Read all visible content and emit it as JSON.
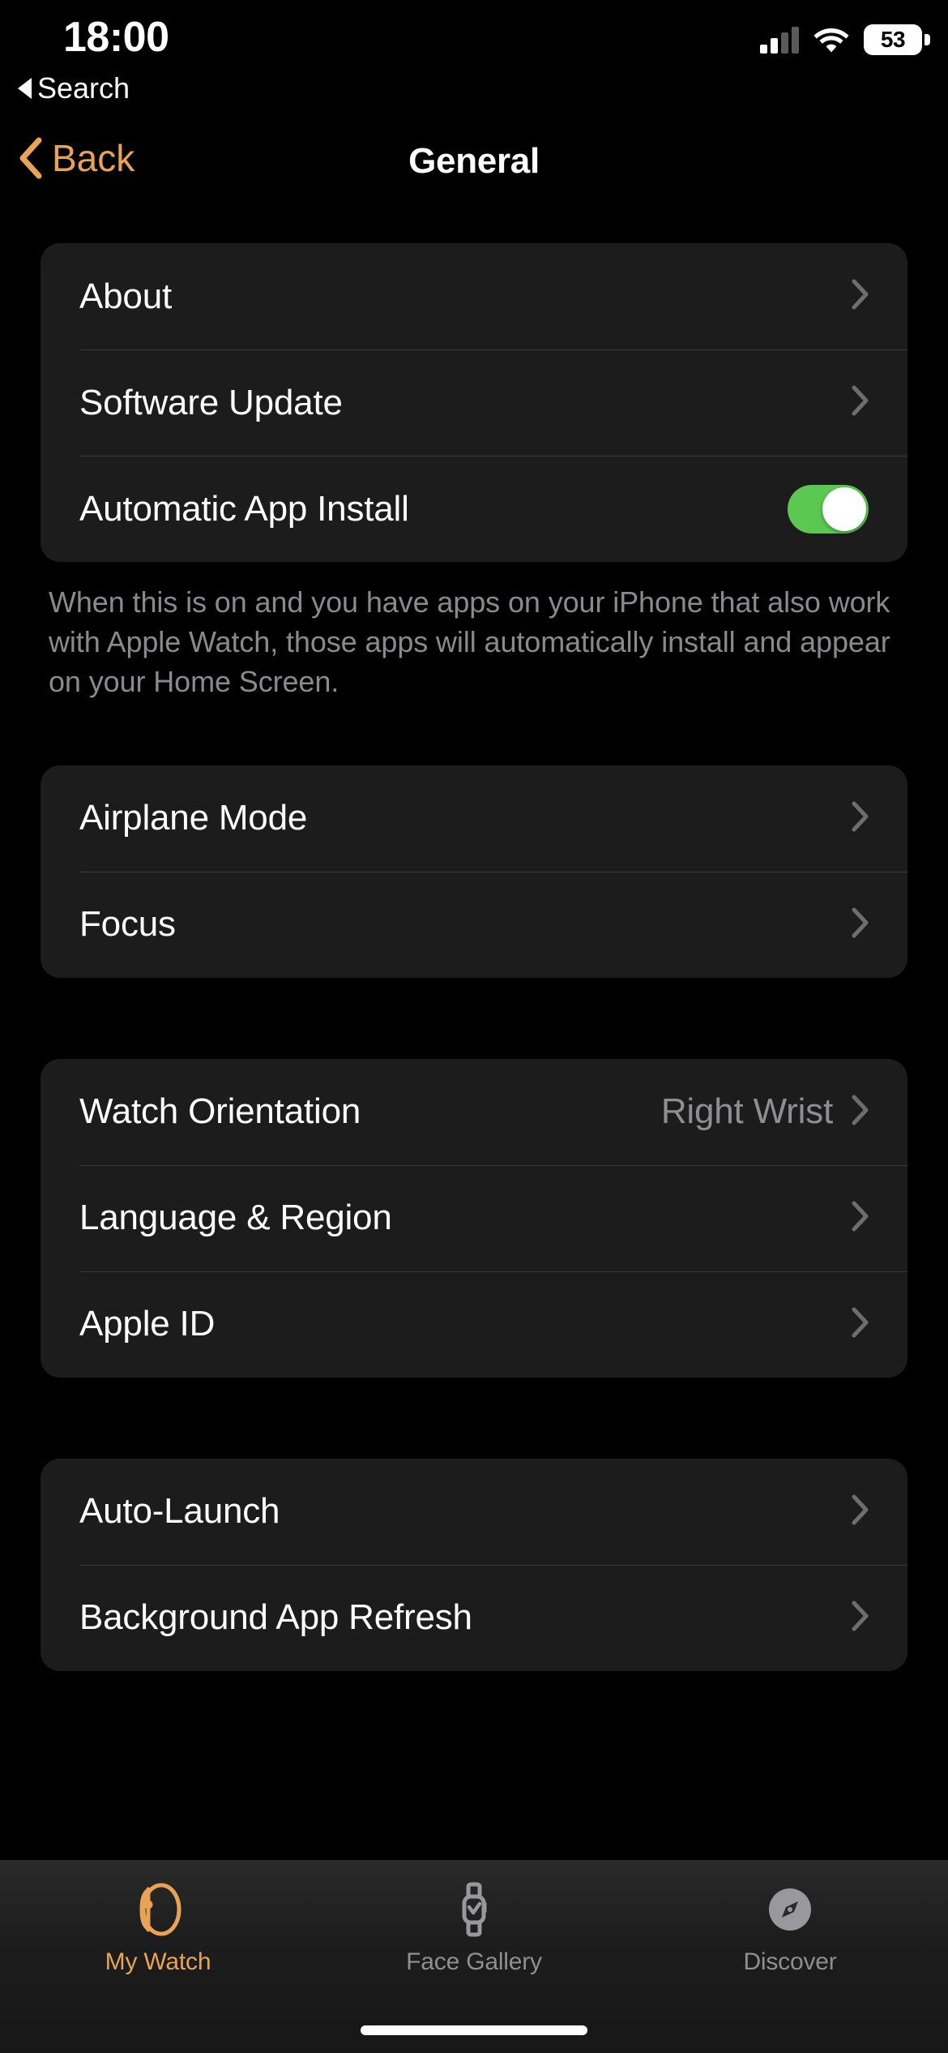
{
  "status_bar": {
    "time": "18:00",
    "back_to_app": "Search",
    "battery_percent": "53",
    "signal_bars_filled": 2,
    "signal_bars_total": 4
  },
  "nav": {
    "back_label": "Back",
    "title": "General"
  },
  "colors": {
    "accent": "#E8A355",
    "toggle_on": "#5BC951",
    "card_background": "#1C1C1C",
    "page_background": "#000000",
    "secondary_text": "#8E8E93"
  },
  "sections": [
    {
      "rows": [
        {
          "label": "About",
          "type": "disclosure"
        },
        {
          "label": "Software Update",
          "type": "disclosure"
        },
        {
          "label": "Automatic App Install",
          "type": "toggle",
          "value": "on"
        }
      ],
      "footnote": "When this is on and you have apps on your iPhone that also work with Apple Watch, those apps will automatically install and appear on your Home Screen."
    },
    {
      "rows": [
        {
          "label": "Airplane Mode",
          "type": "disclosure"
        },
        {
          "label": "Focus",
          "type": "disclosure"
        }
      ]
    },
    {
      "rows": [
        {
          "label": "Watch Orientation",
          "type": "disclosure",
          "value": "Right Wrist"
        },
        {
          "label": "Language & Region",
          "type": "disclosure"
        },
        {
          "label": "Apple ID",
          "type": "disclosure"
        }
      ]
    },
    {
      "rows": [
        {
          "label": "Auto-Launch",
          "type": "disclosure"
        },
        {
          "label": "Background App Refresh",
          "type": "disclosure"
        }
      ]
    }
  ],
  "tabs": [
    {
      "label": "My Watch",
      "icon": "watch-side-icon",
      "active": true
    },
    {
      "label": "Face Gallery",
      "icon": "watch-face-icon",
      "active": false
    },
    {
      "label": "Discover",
      "icon": "compass-icon",
      "active": false
    }
  ]
}
